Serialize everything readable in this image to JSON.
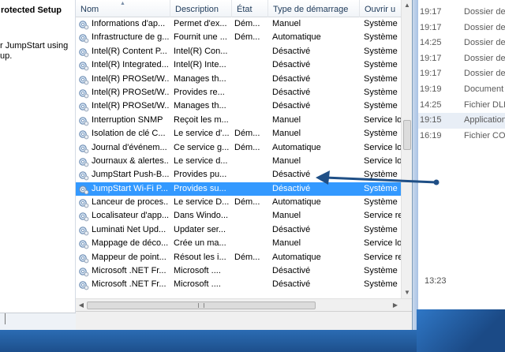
{
  "left_pane": {
    "title": "rotected Setup",
    "description": "r JumpStart using\nup."
  },
  "columns": [
    "Nom",
    "Description",
    "État",
    "Type de démarrage",
    "Ouvrir u"
  ],
  "rows": [
    {
      "name": "Informations d'ap...",
      "desc": "Permet d'ex...",
      "state": "Dém...",
      "start": "Manuel",
      "logon": "Système"
    },
    {
      "name": "Infrastructure de g...",
      "desc": "Fournit une ...",
      "state": "Dém...",
      "start": "Automatique",
      "logon": "Système"
    },
    {
      "name": "Intel(R) Content P...",
      "desc": "Intel(R) Con...",
      "state": "",
      "start": "Désactivé",
      "logon": "Système"
    },
    {
      "name": "Intel(R) Integrated...",
      "desc": "Intel(R) Inte...",
      "state": "",
      "start": "Désactivé",
      "logon": "Système"
    },
    {
      "name": "Intel(R) PROSet/W...",
      "desc": "Manages th...",
      "state": "",
      "start": "Désactivé",
      "logon": "Système"
    },
    {
      "name": "Intel(R) PROSet/W...",
      "desc": "Provides re...",
      "state": "",
      "start": "Désactivé",
      "logon": "Système"
    },
    {
      "name": "Intel(R) PROSet/W...",
      "desc": "Manages th...",
      "state": "",
      "start": "Désactivé",
      "logon": "Système"
    },
    {
      "name": "Interruption SNMP",
      "desc": "Reçoit les m...",
      "state": "",
      "start": "Manuel",
      "logon": "Service lo"
    },
    {
      "name": "Isolation de clé C...",
      "desc": "Le service d'...",
      "state": "Dém...",
      "start": "Manuel",
      "logon": "Système"
    },
    {
      "name": "Journal d'événem...",
      "desc": "Ce service g...",
      "state": "Dém...",
      "start": "Automatique",
      "logon": "Service lo"
    },
    {
      "name": "Journaux & alertes...",
      "desc": "Le service d...",
      "state": "",
      "start": "Manuel",
      "logon": "Service lo"
    },
    {
      "name": "JumpStart Push-B...",
      "desc": "Provides pu...",
      "state": "",
      "start": "Désactivé",
      "logon": "Système"
    },
    {
      "name": "JumpStart Wi-Fi P...",
      "desc": "Provides su...",
      "state": "",
      "start": "Désactivé",
      "logon": "Système"
    },
    {
      "name": "Lanceur de proces...",
      "desc": "Le service D...",
      "state": "Dém...",
      "start": "Automatique",
      "logon": "Système"
    },
    {
      "name": "Localisateur d'app...",
      "desc": "Dans Windo...",
      "state": "",
      "start": "Manuel",
      "logon": "Service re"
    },
    {
      "name": "Luminati Net Upd...",
      "desc": "Updater ser...",
      "state": "",
      "start": "Désactivé",
      "logon": "Système"
    },
    {
      "name": "Mappage de déco...",
      "desc": "Crée un ma...",
      "state": "",
      "start": "Manuel",
      "logon": "Service lo"
    },
    {
      "name": "Mappeur de point...",
      "desc": "Résout les i...",
      "state": "Dém...",
      "start": "Automatique",
      "logon": "Service re"
    },
    {
      "name": "Microsoft .NET Fr...",
      "desc": "Microsoft ....",
      "state": "",
      "start": "Désactivé",
      "logon": "Système"
    },
    {
      "name": "Microsoft .NET Fr...",
      "desc": "Microsoft ....",
      "state": "",
      "start": "Désactivé",
      "logon": "Système"
    }
  ],
  "selected_index": 12,
  "bg_window": {
    "rows": [
      {
        "time": "19:17",
        "type": "Dossier de"
      },
      {
        "time": "19:17",
        "type": "Dossier de"
      },
      {
        "time": "14:25",
        "type": "Dossier de"
      },
      {
        "time": "19:17",
        "type": "Dossier de"
      },
      {
        "time": "19:17",
        "type": "Dossier de"
      },
      {
        "time": "19:19",
        "type": "Document"
      },
      {
        "time": "14:25",
        "type": "Fichier DLL"
      },
      {
        "time": "19:15",
        "type": "Application"
      },
      {
        "time": "16:19",
        "type": "Fichier CO"
      }
    ],
    "bottom_time": "13:23"
  },
  "colors": {
    "selection": "#3399ff",
    "arrow": "#1f4f86",
    "desktop": "#1d4f8c"
  }
}
